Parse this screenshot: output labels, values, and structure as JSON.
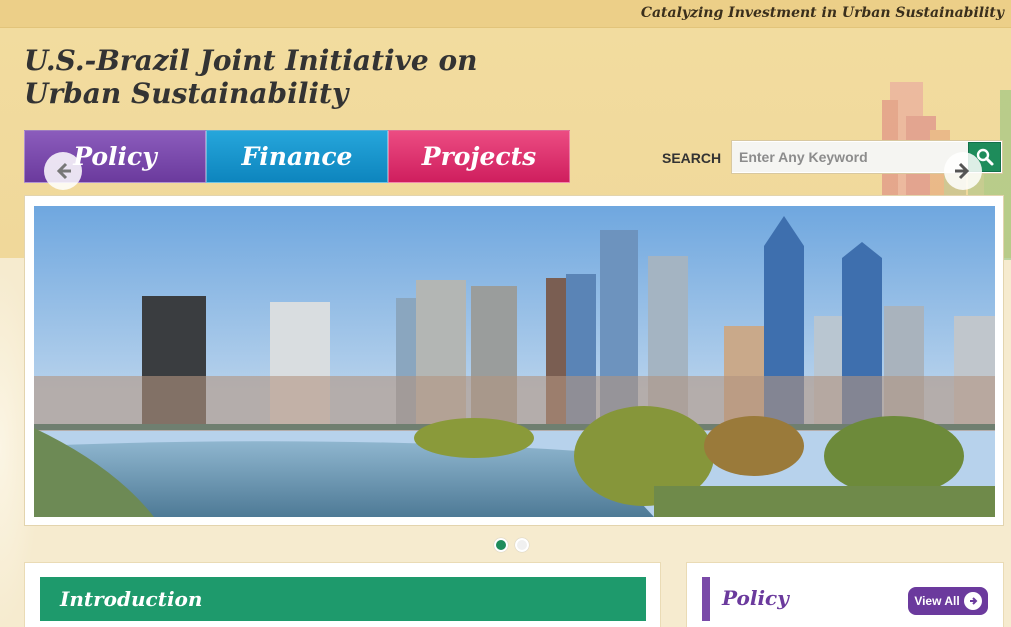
{
  "header": {
    "tagline": "Catalyzing Investment in Urban Sustainability",
    "site_title": "U.S.-Brazil Joint Initiative on Urban Sustainability"
  },
  "nav": {
    "items": [
      {
        "label": "Policy",
        "color": "#6b3a9d"
      },
      {
        "label": "Finance",
        "color": "#0d85be"
      },
      {
        "label": "Projects",
        "color": "#cf1e5e"
      }
    ]
  },
  "search": {
    "label": "SEARCH",
    "placeholder": "Enter Any Keyword",
    "value": "",
    "button_icon": "search-icon"
  },
  "slider": {
    "image_alt": "city-skyline-photo",
    "prev_icon": "arrow-left-icon",
    "next_icon": "arrow-right-icon",
    "active_index": 0,
    "slide_count": 2
  },
  "intro": {
    "title": "Introduction",
    "color": "#1e9a6c"
  },
  "policy_panel": {
    "title": "Policy",
    "view_all_label": "View All",
    "view_all_icon": "arrow-circle-right-icon",
    "color": "#6b3a9d"
  }
}
